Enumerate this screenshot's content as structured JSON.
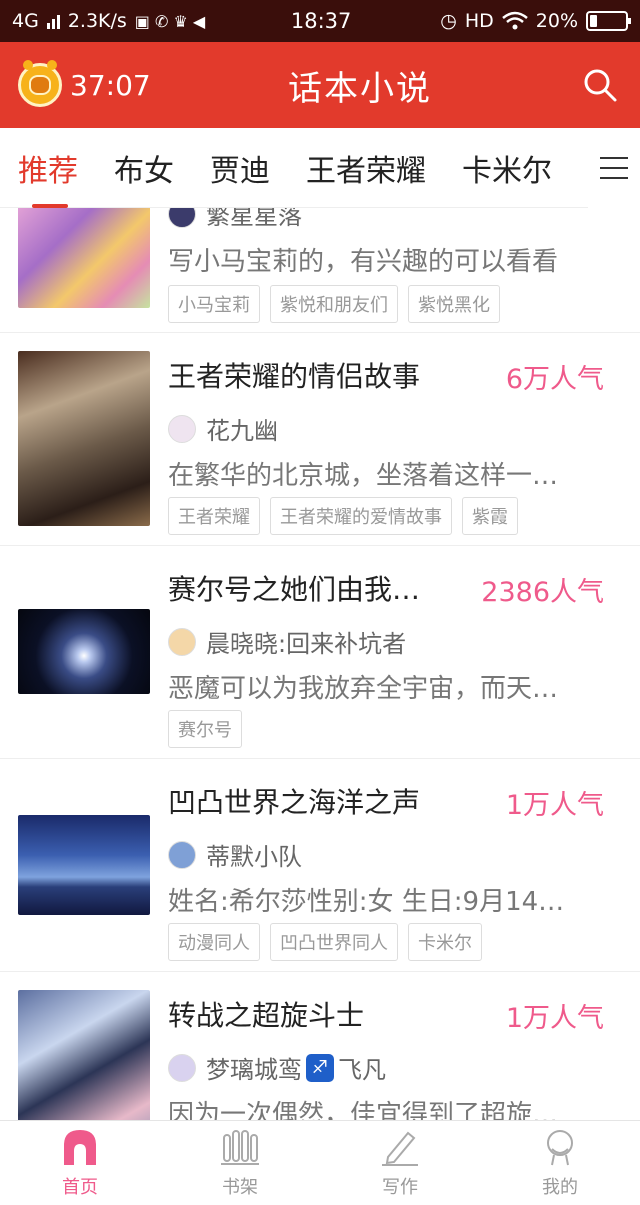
{
  "status_bar": {
    "network": "4G",
    "speed": "2.3K/s",
    "time": "18:37",
    "hd": "HD",
    "battery": "20%",
    "battery_level": 0.2
  },
  "header": {
    "timer": "37:07",
    "title": "话本小说",
    "accent_color": "#e23a2c"
  },
  "tabs": [
    "推荐",
    "布女",
    "贾迪",
    "王者荣耀",
    "卡米尔"
  ],
  "books": [
    {
      "author": "繁星星落",
      "desc": "写小马宝莉的，有兴趣的可以看看",
      "tags": [
        "小马宝莉",
        "紫悦和朋友们",
        "紫悦黑化"
      ]
    },
    {
      "title": "王者荣耀的情侣故事",
      "popularity": "6万人气",
      "author": "花九幽",
      "desc": "在繁华的北京城，坐落着这样一…",
      "tags": [
        "王者荣耀",
        "王者荣耀的爱情故事",
        "紫霞"
      ]
    },
    {
      "title": "赛尔号之她们由我…",
      "popularity": "2386人气",
      "author": "晨晓晓:回来补坑者",
      "desc": "恶魔可以为我放弃全宇宙，而天…",
      "tags": [
        "赛尔号"
      ]
    },
    {
      "title": "凹凸世界之海洋之声",
      "popularity": "1万人气",
      "author": "蒂默小队",
      "desc": "姓名:希尔莎性别:女 生日:9月14…",
      "tags": [
        "动漫同人",
        "凹凸世界同人",
        "卡米尔"
      ]
    },
    {
      "title": "转战之超旋斗士",
      "popularity": "1万人气",
      "author_a": "梦璃城鸾",
      "author_b": "飞凡",
      "desc": "因为一次偶然，佳宜得到了超旋…"
    }
  ],
  "bottom_nav": {
    "home": "首页",
    "shelf": "书架",
    "write": "写作",
    "mine": "我的",
    "active_color": "#ef5a8b"
  }
}
